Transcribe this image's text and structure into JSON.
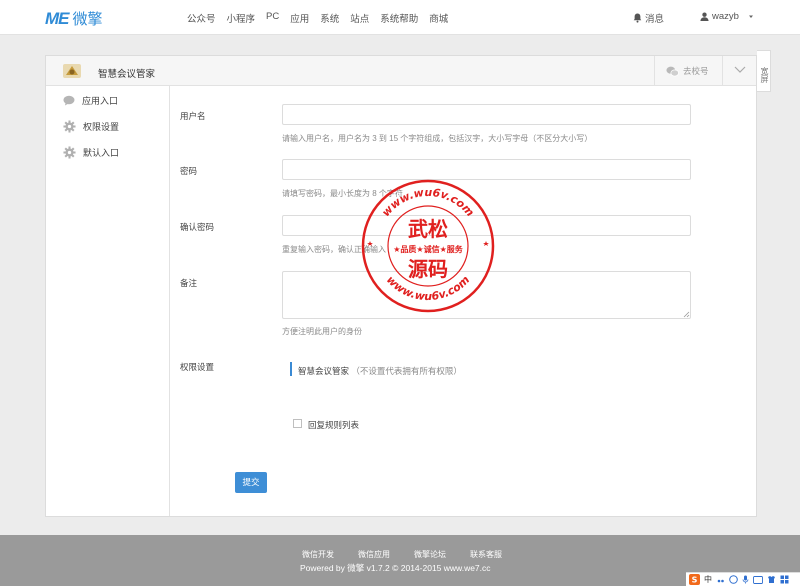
{
  "brand": {
    "mark": "ME",
    "name": "微擎"
  },
  "nav": {
    "items": [
      "公众号",
      "小程序",
      "PC",
      "应用",
      "系统",
      "站点",
      "系统帮助",
      "商城"
    ],
    "messages": "消息",
    "username": "wazyb"
  },
  "panel": {
    "app_name": "智慧会议管家",
    "switch_label": "去校号",
    "side_tab": "宽屏"
  },
  "sidebar": {
    "items": [
      "应用入口",
      "权限设置",
      "默认入口"
    ]
  },
  "form": {
    "username": {
      "label": "用户名",
      "value": "",
      "help": "请输入用户名，用户名为 3 到 15 个字符组成，包括汉字，大小写字母（不区分大小写）"
    },
    "password": {
      "label": "密码",
      "value": "",
      "help": "请填写密码，最小长度为 8 个字符"
    },
    "confirm": {
      "label": "确认密码",
      "value": "",
      "help": "重复输入密码，确认正确输入"
    },
    "remark": {
      "label": "备注",
      "value": "",
      "help": "方便注明此用户的身份"
    },
    "permission": {
      "label": "权限设置",
      "module": "智慧会议管家",
      "module_note": "（不设置代表拥有所有权限）",
      "checkbox_label": "回复规则列表",
      "checked": false
    },
    "submit": "提交"
  },
  "footer": {
    "links": [
      "微信开发",
      "微信应用",
      "微擎论坛",
      "联系客服"
    ],
    "copyright": "Powered by 微擎 v1.7.2 © 2014-2015 www.we7.cc"
  },
  "stamp": {
    "top_text": "www.wu6v.com",
    "bottom_text": "www.wu6v.com",
    "line1": "武松",
    "line2": "★品质★诚信★服务",
    "line3": "源码",
    "color": "#e0201f"
  },
  "ime": {
    "label": "中"
  },
  "colors": {
    "accent": "#3e8ed6",
    "brand": "#2f8bd6",
    "footer": "#9a9a9a"
  }
}
